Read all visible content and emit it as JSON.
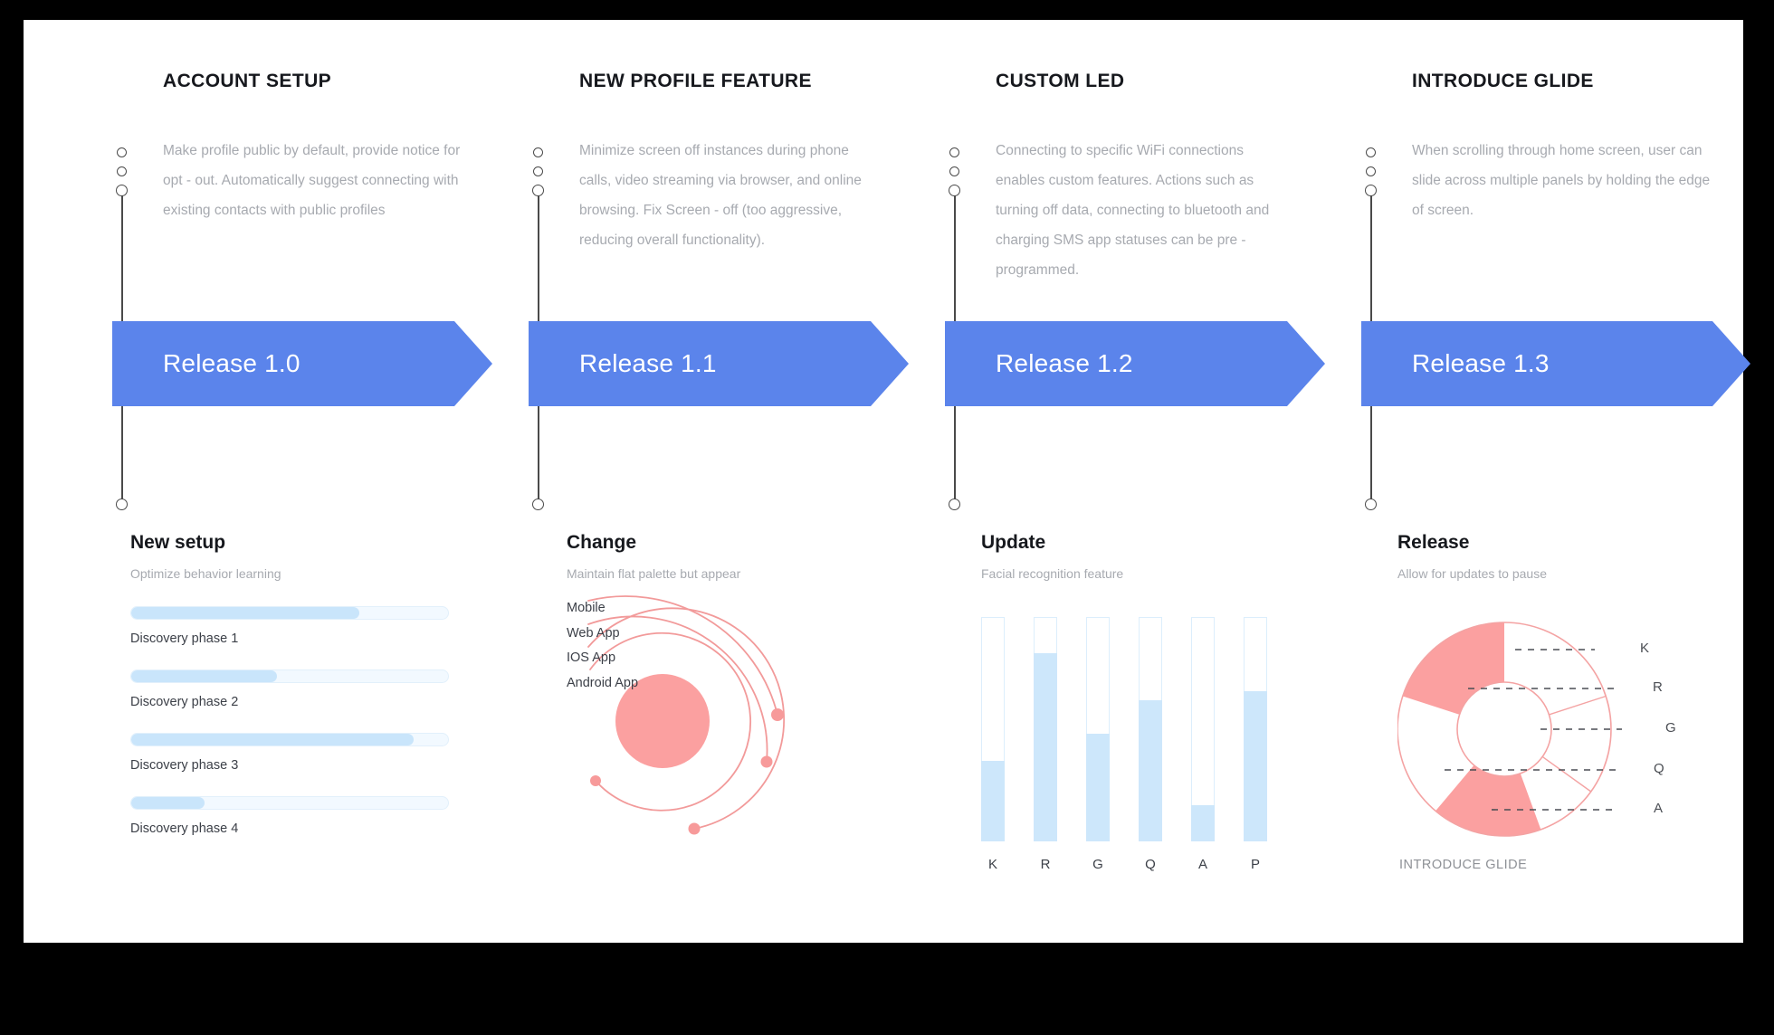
{
  "theme": {
    "accent_blue": "#5b84eb",
    "light_blue": "#cde7fb",
    "coral": "#fba0a0",
    "text_dark": "#16181d",
    "text_muted": "#a7aab0"
  },
  "timeline": {
    "columns": [
      {
        "title": "ACCOUNT SETUP",
        "description": "Make profile public by default, provide notice for opt - out. Automatically suggest connecting with existing contacts with public profiles",
        "release_label": "Release 1.0"
      },
      {
        "title": "NEW PROFILE FEATURE",
        "description": "Minimize screen off instances during phone calls, video streaming via browser, and online browsing. Fix Screen - off (too aggressive, reducing overall functionality).",
        "release_label": "Release 1.1"
      },
      {
        "title": "CUSTOM LED",
        "description": "Connecting to specific WiFi connections enables custom features. Actions such as turning off data, connecting to bluetooth and charging SMS app statuses can be pre - programmed.",
        "release_label": "Release 1.2"
      },
      {
        "title": "INTRODUCE GLIDE",
        "description": "When scrolling through home screen, user can slide across multiple panels by holding the edge of screen.",
        "release_label": "Release 1.3"
      }
    ]
  },
  "widgets": {
    "new_setup": {
      "title": "New setup",
      "subtitle": "Optimize behavior learning"
    },
    "change": {
      "title": "Change",
      "subtitle": "Maintain flat palette but appear"
    },
    "update": {
      "title": "Update",
      "subtitle": "Facial recognition feature"
    },
    "release": {
      "title": "Release",
      "subtitle": "Allow for updates to pause",
      "footer": "INTRODUCE GLIDE"
    }
  },
  "chart_data": [
    {
      "type": "bar",
      "title": "New setup",
      "subtitle": "Optimize behavior learning",
      "orientation": "horizontal",
      "categories": [
        "Discovery phase 1",
        "Discovery phase 2",
        "Discovery phase 3",
        "Discovery phase 4"
      ],
      "values": [
        72,
        46,
        89,
        23
      ],
      "ylim": [
        0,
        100
      ],
      "xlabel": "",
      "ylabel": "",
      "grid": false,
      "legend": "none"
    },
    {
      "type": "line",
      "title": "Change",
      "subtitle": "Maintain flat palette but appear",
      "note": "concentric arc / orbit diagram, four nested arcs each terminating in a dot",
      "categories": [
        "Mobile",
        "Web App",
        "IOS App",
        "Android App"
      ],
      "values": [
        4,
        3,
        2,
        1
      ],
      "legend": "left"
    },
    {
      "type": "bar",
      "title": "Update",
      "subtitle": "Facial recognition feature",
      "categories": [
        "K",
        "R",
        "G",
        "Q",
        "A",
        "P"
      ],
      "values": [
        36,
        84,
        48,
        63,
        16,
        67
      ],
      "ylim": [
        0,
        100
      ],
      "xlabel": "",
      "ylabel": "",
      "grid": false,
      "legend": "none"
    },
    {
      "type": "pie",
      "title": "Release",
      "subtitle": "Allow for updates to pause",
      "note": "donut chart, filled coral segments alternate with unfilled (white) segments",
      "labels": [
        "K",
        "R",
        "G",
        "Q",
        "A"
      ],
      "values": [
        20,
        22,
        13,
        25,
        20
      ],
      "legend": "right"
    }
  ],
  "progress_bars": {
    "items": [
      {
        "label": "Discovery phase 1",
        "percent": 72
      },
      {
        "label": "Discovery phase 2",
        "percent": 46
      },
      {
        "label": "Discovery phase 3",
        "percent": 89
      },
      {
        "label": "Discovery phase 4",
        "percent": 23
      }
    ]
  },
  "orbit": {
    "legend": [
      "Mobile",
      "Web App",
      "IOS App",
      "Android App"
    ]
  },
  "bar_chart": {
    "bars": [
      {
        "label": "K",
        "percent": 36
      },
      {
        "label": "R",
        "percent": 84
      },
      {
        "label": "G",
        "percent": 48
      },
      {
        "label": "Q",
        "percent": 63
      },
      {
        "label": "A",
        "percent": 16
      },
      {
        "label": "P",
        "percent": 67
      }
    ]
  },
  "donut": {
    "labels": [
      "K",
      "R",
      "G",
      "Q",
      "A"
    ]
  }
}
